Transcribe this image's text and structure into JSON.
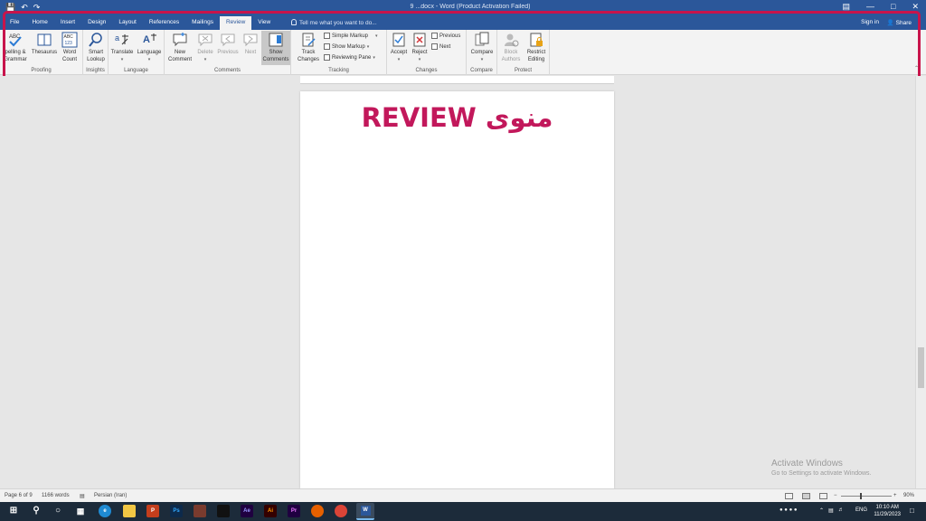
{
  "window": {
    "title": "9 ...docx - Word (Product Activation Failed)"
  },
  "tabs": [
    {
      "label": "File"
    },
    {
      "label": "Home"
    },
    {
      "label": "Insert"
    },
    {
      "label": "Design"
    },
    {
      "label": "Layout"
    },
    {
      "label": "References"
    },
    {
      "label": "Mailings"
    },
    {
      "label": "Review"
    },
    {
      "label": "View"
    }
  ],
  "tellme": {
    "placeholder": "Tell me what you want to do..."
  },
  "account": {
    "signin": "Sign in",
    "share": "Share"
  },
  "ribbon": {
    "proofing": {
      "label": "Proofing",
      "spelling": "pelling &\nGrammar",
      "thesaurus": "Thesaurus",
      "wordcount": "Word\nCount",
      "abc_icon_text": "ABC",
      "abc123_icon_text": "ABC\n123"
    },
    "insights": {
      "label": "Insights",
      "smart_lookup": "Smart\nLookup"
    },
    "language": {
      "label": "Language",
      "translate": "Translate",
      "language": "Language"
    },
    "comments": {
      "label": "Comments",
      "new": "New\nComment",
      "delete": "Delete",
      "previous": "Previous",
      "next": "Next",
      "show": "Show\nComments"
    },
    "tracking": {
      "label": "Tracking",
      "track_changes": "Track\nChanges",
      "simple_markup": "Simple Markup",
      "show_markup": "Show Markup",
      "reviewing_pane": "Reviewing Pane"
    },
    "changes": {
      "label": "Changes",
      "accept": "Accept",
      "reject": "Reject",
      "previous": "Previous",
      "next": "Next"
    },
    "compare": {
      "label": "Compare",
      "compare": "Compare"
    },
    "protect": {
      "label": "Protect",
      "block_authors": "Block\nAuthors",
      "restrict_editing": "Restrict\nEditing"
    }
  },
  "document": {
    "heading": "منوی REVIEW"
  },
  "watermark": {
    "line1": "Activate Windows",
    "line2": "Go to Settings to activate Windows."
  },
  "status": {
    "page": "Page 6 of 9",
    "words": "1166 words",
    "language": "Persian (Iran)",
    "zoom": "90%"
  },
  "taskbar": {
    "language": "ENG",
    "time": "10:10 AM",
    "date": "11/29/2023"
  },
  "colors": {
    "word_blue": "#2b579a",
    "highlight": "#c8144b",
    "heading": "#c2185b"
  }
}
